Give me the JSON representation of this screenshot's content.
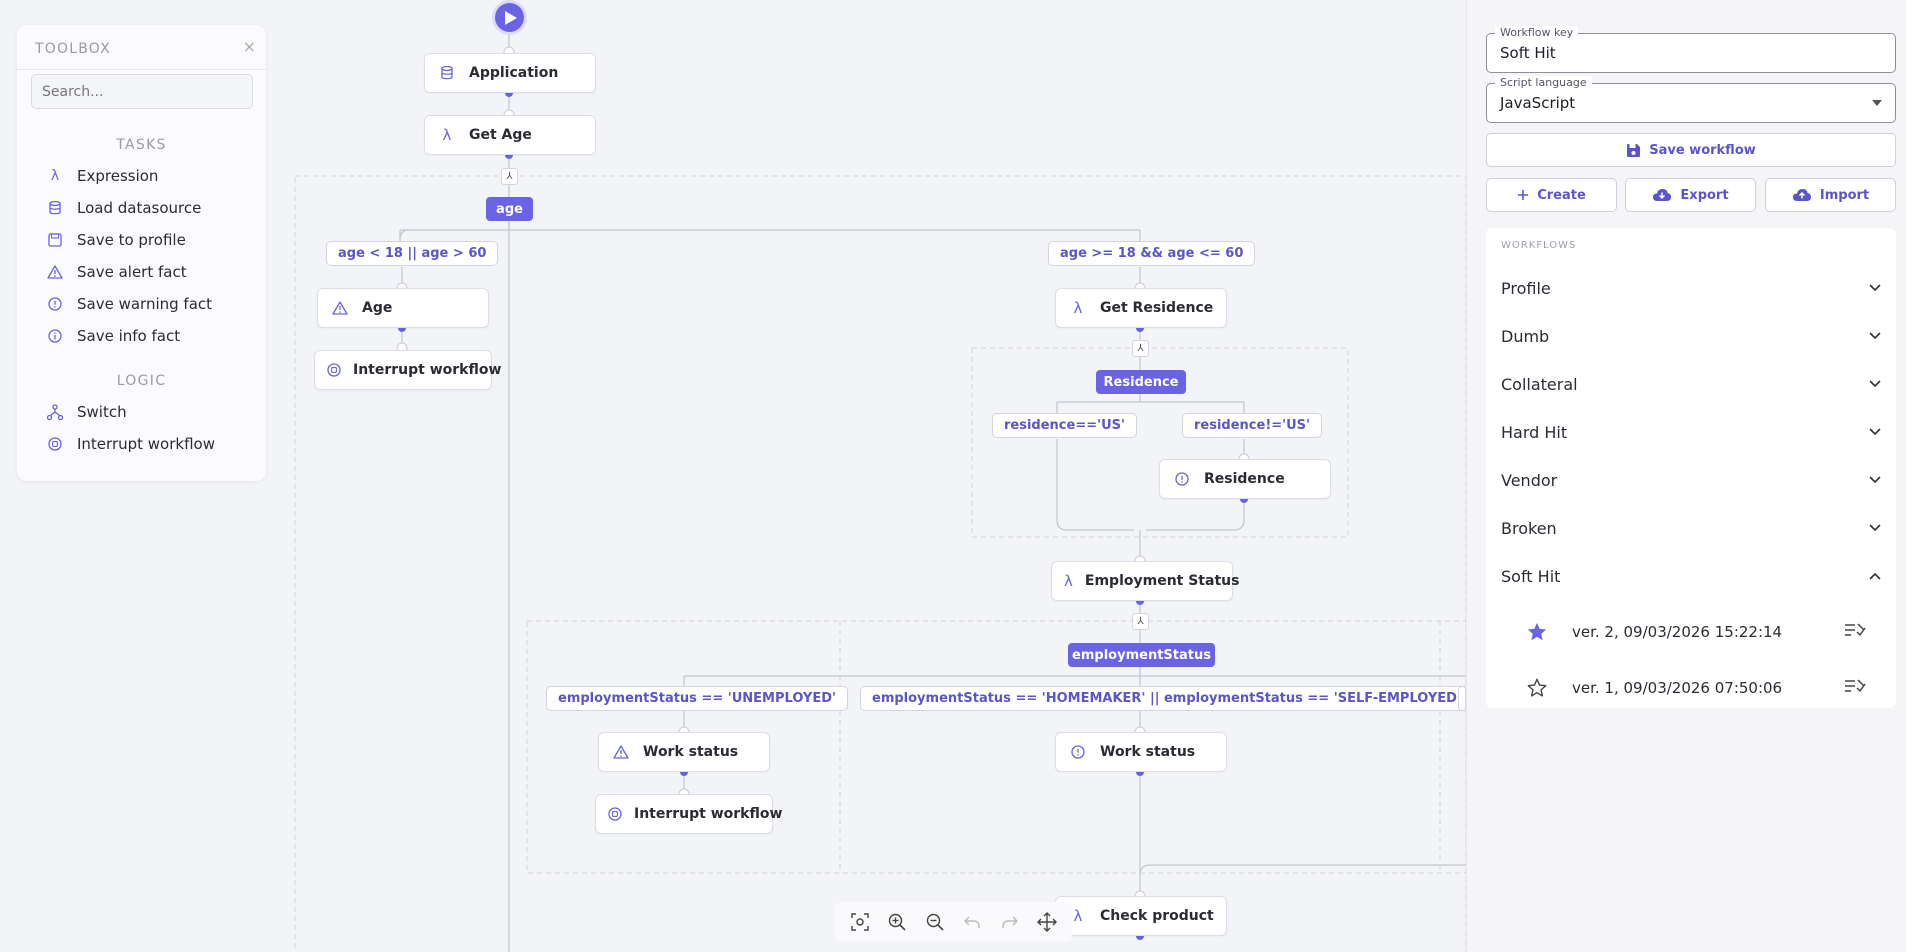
{
  "toolbox": {
    "title": "TOOLBOX",
    "search_placeholder": "Search...",
    "sections": [
      {
        "label": "TASKS",
        "items": [
          "Expression",
          "Load datasource",
          "Save to profile",
          "Save alert fact",
          "Save warning fact",
          "Save info fact"
        ]
      },
      {
        "label": "LOGIC",
        "items": [
          "Switch",
          "Interrupt workflow"
        ]
      }
    ]
  },
  "canvas": {
    "nodes": {
      "application": "Application",
      "get_age": "Get Age",
      "age": "Age",
      "interrupt1": "Interrupt workflow",
      "get_residence": "Get Residence",
      "residence": "Residence",
      "employment_status": "Employment Status",
      "work_status1": "Work status",
      "interrupt2": "Interrupt workflow",
      "work_status2": "Work status",
      "check_product": "Check product"
    },
    "switches": {
      "age": "age",
      "residence": "Residence",
      "employment": "employmentStatus"
    },
    "conditions": {
      "age_out": "age < 18 || age > 60",
      "age_in": "age >= 18 && age <= 60",
      "res_us": "residence=='US'",
      "res_not_us": "residence!='US'",
      "emp_unemployed": "employmentStatus == 'UNEMPLOYED'",
      "emp_home": "employmentStatus == 'HOMEMAKER' || employmentStatus == 'SELF-EMPLOYEDR'"
    }
  },
  "panel": {
    "workflow_key_label": "Workflow key",
    "workflow_key_value": "Soft Hit",
    "script_language_label": "Script language",
    "script_language_value": "JavaScript",
    "save_label": "Save workflow",
    "create_label": "Create",
    "export_label": "Export",
    "import_label": "Import",
    "workflows_title": "WORKFLOWS",
    "workflows": [
      "Profile",
      "Dumb",
      "Collateral",
      "Hard Hit",
      "Vendor",
      "Broken",
      "Soft Hit"
    ],
    "versions": [
      {
        "label": "ver. 2, 09/03/2026 15:22:14",
        "starred": true
      },
      {
        "label": "ver. 1, 09/03/2026 07:50:06",
        "starred": false
      }
    ]
  },
  "colors": {
    "accent": "#6a63e6",
    "background": "#f3f4f7",
    "panel": "#f5f5f8"
  }
}
